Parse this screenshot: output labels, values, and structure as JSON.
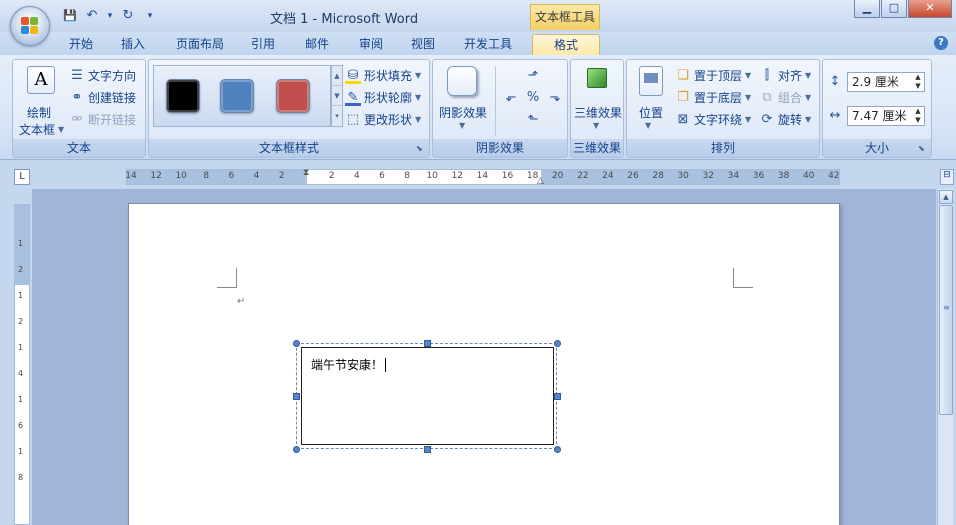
{
  "window": {
    "title": "文档 1 - Microsoft Word",
    "context_tab_title": "文本框工具",
    "controls": {
      "minimize": "▁",
      "maximize": "□",
      "close": "✕"
    }
  },
  "qat": {
    "save": "💾",
    "undo": "↶",
    "undo_caret": "▾",
    "redo": "↻",
    "customize": "▾"
  },
  "tabs": [
    {
      "label": "开始"
    },
    {
      "label": "插入"
    },
    {
      "label": "页面布局"
    },
    {
      "label": "引用"
    },
    {
      "label": "邮件"
    },
    {
      "label": "审阅"
    },
    {
      "label": "视图"
    },
    {
      "label": "开发工具"
    },
    {
      "label": "格式",
      "active": true
    }
  ],
  "help": "?",
  "ribbon": {
    "text_group": {
      "label": "文本",
      "draw_textbox_line1": "绘制",
      "draw_textbox_line2": "文本框",
      "text_direction": "文字方向",
      "create_link": "创建链接",
      "break_link": "断开链接"
    },
    "style_group": {
      "label": "文本框样式",
      "swatches": [
        "#000000",
        "#4f81bd",
        "#c0504d"
      ],
      "shape_fill": "形状填充",
      "shape_outline": "形状轮廓",
      "change_shape": "更改形状"
    },
    "shadow_group": {
      "label": "阴影效果",
      "shadow_effects": "阴影效果"
    },
    "threed_group": {
      "label": "三维效果",
      "threed_effects": "三维效果"
    },
    "arrange_group": {
      "label": "排列",
      "position": "位置",
      "bring_front": "置于顶层",
      "send_back": "置于底层",
      "text_wrap": "文字环绕",
      "align": "对齐",
      "group": "组合",
      "rotate": "旋转"
    },
    "size_group": {
      "label": "大小",
      "height": "2.9 厘米",
      "width": "7.47 厘米"
    }
  },
  "ruler": {
    "corner": "L",
    "ticks": [
      "14",
      "12",
      "10",
      "8",
      "6",
      "4",
      "2",
      "",
      "2",
      "4",
      "6",
      "8",
      "10",
      "12",
      "14",
      "16",
      "18",
      "20",
      "22",
      "24",
      "26",
      "28",
      "30",
      "32",
      "34",
      "36",
      "38",
      "40",
      "42"
    ],
    "vticks": [
      "1",
      "2",
      "1",
      "2",
      "1",
      "4",
      "1",
      "6",
      "1",
      "8"
    ]
  },
  "document": {
    "textbox_text": "端午节安康！",
    "para_mark": "↵"
  }
}
